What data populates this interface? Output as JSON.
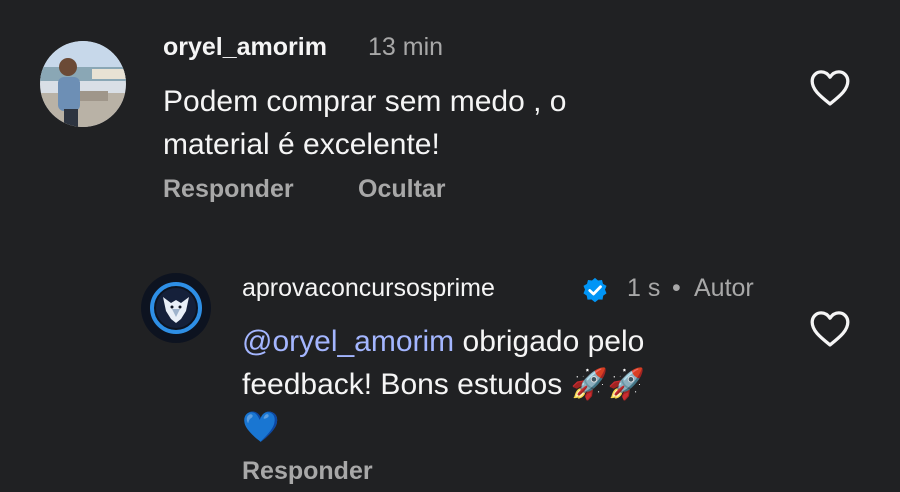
{
  "comment": {
    "username": "oryel_amorim",
    "time": "13 min",
    "text_line1": "Podem comprar sem medo , o",
    "text_line2": "material é excelente!",
    "reply_label": "Responder",
    "hide_label": "Ocultar"
  },
  "reply": {
    "username": "aprovaconcursosprime",
    "time": "1 s",
    "separator": "•",
    "author_label": "Autor",
    "mention": "@oryel_amorim",
    "text_part1": " obrigado pelo",
    "text_line2": "feedback! Bons estudos 🚀🚀",
    "text_line3": "💙",
    "reply_label": "Responder"
  },
  "colors": {
    "background": "#202123",
    "text": "#f5f5f5",
    "muted": "#a8a8a8",
    "mention": "#a4b6ff",
    "verified": "#0095f6"
  },
  "icons": {
    "like": "heart-outline-icon",
    "verified": "verified-badge-icon"
  }
}
